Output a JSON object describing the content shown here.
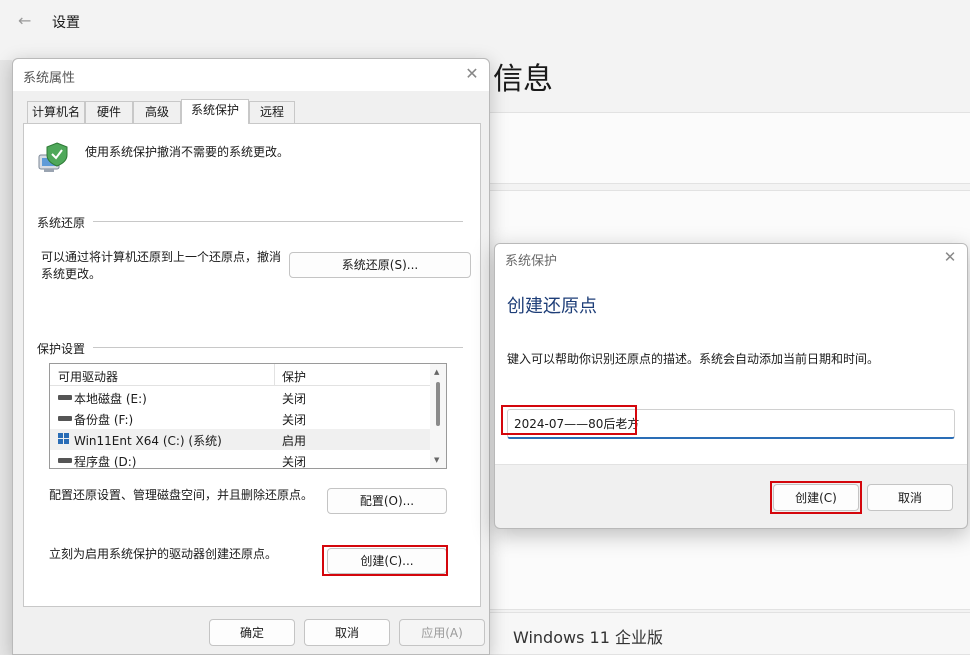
{
  "settings": {
    "back_icon": "back-arrow-icon",
    "title": "设置",
    "heading": "信息",
    "windows_edition": "Windows 11 企业版"
  },
  "system_properties": {
    "title": "系统属性",
    "tabs": [
      {
        "label": "计算机名"
      },
      {
        "label": "硬件"
      },
      {
        "label": "高级"
      },
      {
        "label": "系统保护"
      },
      {
        "label": "远程"
      }
    ],
    "active_tab": "系统保护",
    "intro": "使用系统保护撤消不需要的系统更改。",
    "restore_group": {
      "title": "系统还原",
      "text_line1": "可以通过将计算机还原到上一个还原点，撤消",
      "text_line2": "系统更改。",
      "button": "系统还原(S)..."
    },
    "protection_group": {
      "title": "保护设置",
      "columns": [
        "可用驱动器",
        "保护"
      ],
      "drives": [
        {
          "name": "本地磁盘 (E:)",
          "protection": "关闭"
        },
        {
          "name": "备份盘 (F:)",
          "protection": "关闭"
        },
        {
          "name": "Win11Ent X64 (C:) (系统)",
          "protection": "启用"
        },
        {
          "name": "程序盘 (D:)",
          "protection": "关闭"
        }
      ],
      "configure_text": "配置还原设置、管理磁盘空间，并且删除还原点。",
      "configure_button": "配置(O)...",
      "create_text": "立刻为启用系统保护的驱动器创建还原点。",
      "create_button": "创建(C)..."
    },
    "footer": {
      "ok": "确定",
      "cancel": "取消",
      "apply": "应用(A)"
    }
  },
  "system_protection": {
    "title": "系统保护",
    "heading": "创建还原点",
    "description": "键入可以帮助你识别还原点的描述。系统会自动添加当前日期和时间。",
    "input_value": "2024-07——80后老方",
    "create_button": "创建(C)",
    "cancel_button": "取消"
  },
  "colors": {
    "highlight_frame": "#d4060c",
    "accent": "#2a6db6",
    "heading_blue": "#1e3e78"
  }
}
